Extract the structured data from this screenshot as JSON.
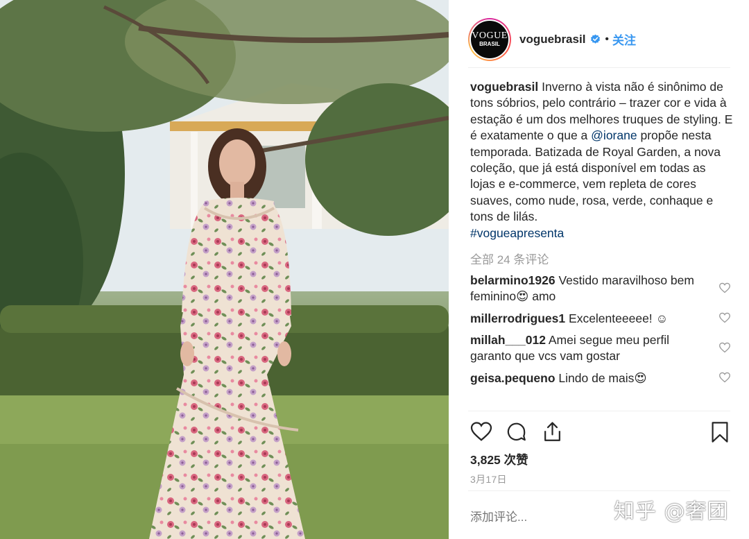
{
  "post": {
    "username": "voguebrasil",
    "avatar_text_top": "VOGUE",
    "avatar_text_bottom": "BRASIL",
    "dot": "•",
    "follow_label": "关注",
    "caption": {
      "username": "voguebrasil",
      "part1": "Inverno à vista não é sinônimo de tons sóbrios, pelo contrário – trazer cor e vida à estação é um dos melhores truques de styling. E é exatamente o que a",
      "mention": "@iorane",
      "part2": "propõe nesta temporada. Batizada de Royal Garden, a nova coleção, que já está disponível em todas as lojas e e-commerce, vem repleta de cores suaves, como nude, rosa, verde, conhaque e tons de lilás.",
      "hashtag": "#vogueapresenta"
    },
    "all_comments_label": "全部 24 条评论",
    "comments": [
      {
        "user": "belarmino1926",
        "text": "Vestido maravilhoso bem feminino😍 amo"
      },
      {
        "user": "millerrodrigues1",
        "text": "Excelenteeeee! ☺"
      },
      {
        "user": "millah___012",
        "text": "Amei segue meu perfil garanto que vcs vam gostar"
      },
      {
        "user": "geisa.pequeno",
        "text": "Lindo de mais😍"
      }
    ],
    "likes_label": "3,825 次赞",
    "date_label": "3月17日",
    "add_comment_placeholder": "添加评论..."
  },
  "watermark": "知乎 @奢团",
  "colors": {
    "link": "#003569",
    "follow": "#3897f0",
    "secondary_text": "#999999",
    "verified": "#3897f0"
  },
  "icons": [
    "like-heart-icon",
    "comment-icon",
    "share-icon",
    "bookmark-icon",
    "verified-badge-icon",
    "comment-like-heart-icon"
  ]
}
